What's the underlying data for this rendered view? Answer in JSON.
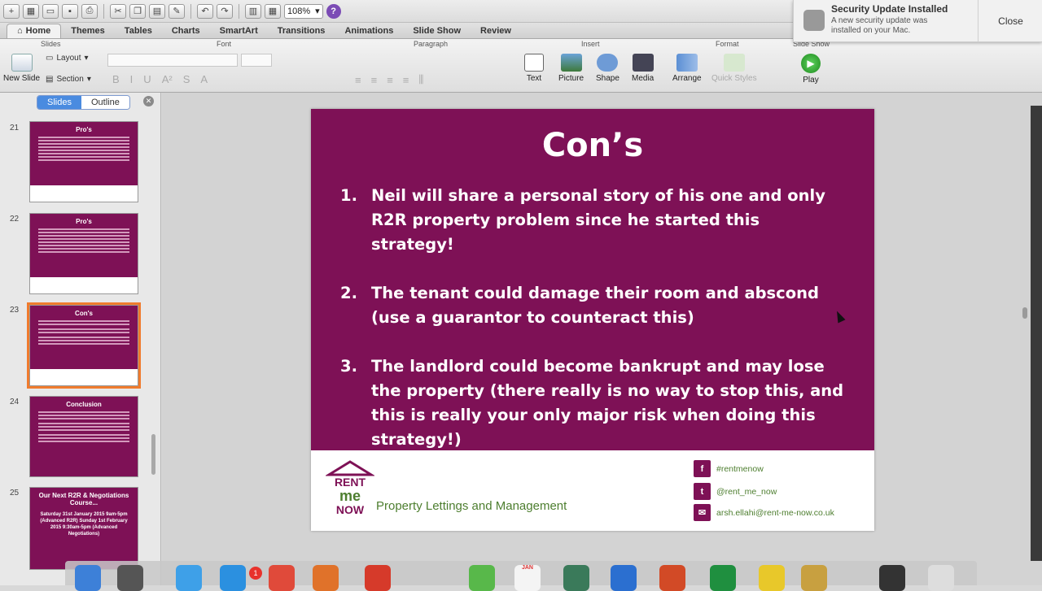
{
  "toolbar": {
    "zoom": "108%"
  },
  "tabs": [
    "Home",
    "Themes",
    "Tables",
    "Charts",
    "SmartArt",
    "Transitions",
    "Animations",
    "Slide Show",
    "Review"
  ],
  "ribbon": {
    "groups": [
      "Slides",
      "Font",
      "Paragraph",
      "Insert",
      "Format",
      "Slide Show"
    ],
    "new_slide": "New Slide",
    "layout": "Layout",
    "section": "Section",
    "insert_items": [
      "Text",
      "Picture",
      "Shape",
      "Media"
    ],
    "format_items": [
      "Arrange",
      "Quick Styles"
    ],
    "play": "Play"
  },
  "sidebar": {
    "seg_slides": "Slides",
    "seg_outline": "Outline",
    "thumbs": [
      {
        "num": "21",
        "title": "Pro's"
      },
      {
        "num": "22",
        "title": "Pro's"
      },
      {
        "num": "23",
        "title": "Con's"
      },
      {
        "num": "24",
        "title": "Conclusion"
      },
      {
        "num": "25",
        "title": "Our Next R2R & Negotiations Course...",
        "text": "Saturday 31st January 2015 9am-5pm (Advanced R2R) Sunday 1st February 2015 9:30am-5pm (Advanced Negotiations)"
      }
    ]
  },
  "slide": {
    "title": "Con’s",
    "points": [
      {
        "num": "1.",
        "text": "Neil will share a personal story of his one and only R2R property problem since he started this strategy!"
      },
      {
        "num": "2.",
        "text": "The tenant could damage their room and abscond (use a guarantor to counteract this)"
      },
      {
        "num": "3.",
        "text": "The landlord could become bankrupt and may lose the property (there really is no way to stop this, and this is really your only major risk when doing this strategy!)"
      }
    ],
    "tagline": "Property Lettings and Management",
    "logo_text": [
      "RENT",
      "me",
      "NOW"
    ],
    "social": [
      "#rentmenow",
      "@rent_me_now",
      "arsh.ellahi@rent-me-now.co.uk"
    ]
  },
  "notification": {
    "title": "Security Update Installed",
    "body": "A new security update was installed on your Mac.",
    "close": "Close"
  },
  "dock": {
    "badge": "1",
    "calendar_month": "JAN"
  },
  "colors": {
    "slide_bg": "#7e1156",
    "accent_green": "#4d7e2f",
    "selection": "#f07b2d"
  }
}
